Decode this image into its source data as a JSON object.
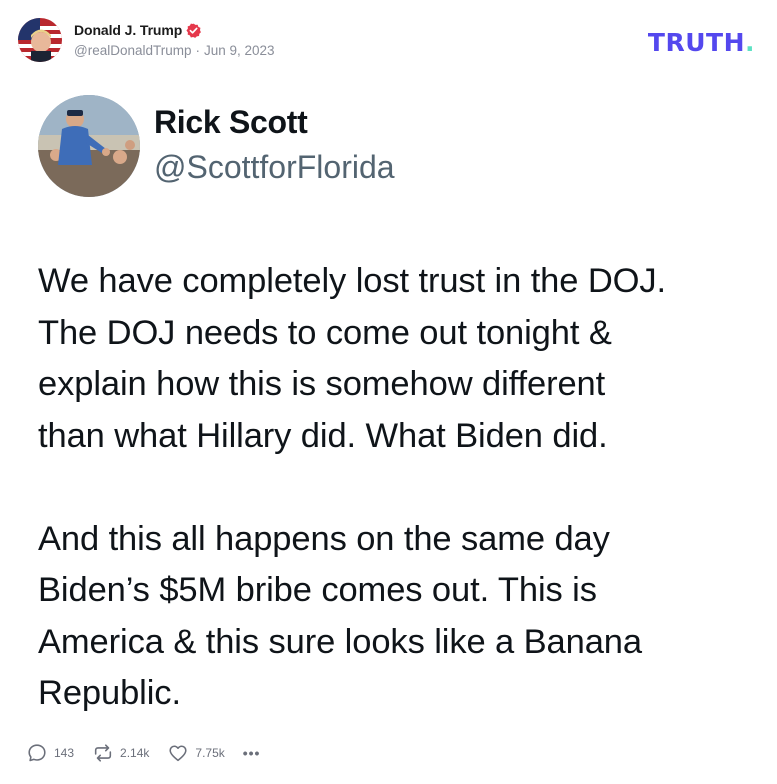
{
  "post": {
    "author_name": "Donald J. Trump",
    "handle": "@realDonaldTrump",
    "separator": "·",
    "date": "Jun 9, 2023",
    "verified": true
  },
  "brand": {
    "logo_text": "TRUTH",
    "logo_dot": ".",
    "colors": {
      "primary": "#5448ee",
      "accent": "#5de2c4"
    }
  },
  "quoted_post": {
    "name": "Rick Scott",
    "handle": "@ScottforFlorida",
    "paragraph_1_lines": [
      "We have completely lost trust in the DOJ.",
      "The DOJ needs to come out tonight &",
      "explain how this is somehow different",
      "than what Hillary did. What Biden did."
    ],
    "paragraph_2_lines": [
      "And this all happens on the same day",
      "Biden’s $5M bribe comes out. This is",
      "America & this sure looks like a Banana",
      "Republic."
    ]
  },
  "actions": {
    "replies": "143",
    "retruths": "2.14k",
    "likes": "7.75k",
    "more": "•••"
  }
}
